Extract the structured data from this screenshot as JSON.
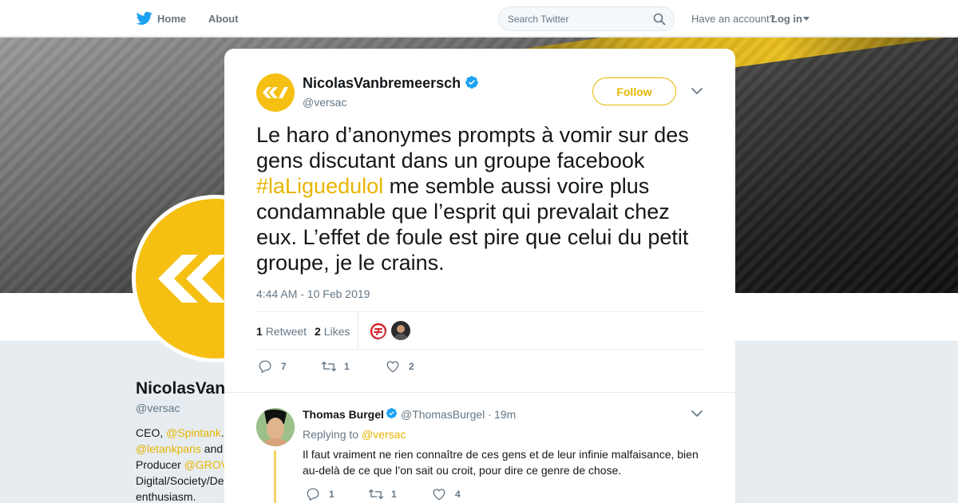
{
  "colors": {
    "accent": "#e8b500",
    "muted": "#657786",
    "text": "#14171a",
    "verified": "#1da1f2"
  },
  "topnav": {
    "home_label": "Home",
    "about_label": "About",
    "search_placeholder": "Search Twitter",
    "account_prompt": "Have an account?",
    "login_label": "Log in"
  },
  "profile_bg": {
    "name": "NicolasVan",
    "handle": "@versac",
    "bio_lines": [
      {
        "pre": "CEO, ",
        "link": "@Spintank",
        "post": "."
      },
      {
        "pre": "",
        "link": "@letankparis",
        "post": " and"
      },
      {
        "pre": "Producer ",
        "link": "@GROV",
        "post": ""
      },
      {
        "pre": "Digital/Society/De",
        "link": "",
        "post": ""
      },
      {
        "pre": "enthusiasm.",
        "link": "",
        "post": ""
      }
    ]
  },
  "tweet": {
    "author_name": "NicolasVanbremeersch",
    "author_handle": "@versac",
    "follow_label": "Follow",
    "text_part1": "Le haro d’anonymes prompts à vomir sur des gens discutant dans un groupe facebook ",
    "hashtag": "#laLiguedulol",
    "text_part2": " me semble aussi voire plus condamnable que l’esprit qui prevalait chez eux. L’effet de foule est pire que celui du petit groupe, je le crains.",
    "timestamp": "4:44 AM - 10 Feb 2019",
    "retweet_count": "1",
    "retweet_label": "Retweet",
    "like_count": "2",
    "like_label": "Likes",
    "actions": {
      "replies": "7",
      "retweets": "1",
      "likes": "2"
    }
  },
  "reply": {
    "author_name": "Thomas Burgel",
    "author_handle": "@ThomasBurgel",
    "separator": "·",
    "time": "19m",
    "replying_label": "Replying to",
    "replying_to": "@versac",
    "text": "Il faut vraiment ne rien connaître de ces gens et de leur infinie malfaisance, bien au-delà de ce que l’on sait ou croit, pour dire ce genre de chose.",
    "actions": {
      "replies": "1",
      "retweets": "1",
      "likes": "4"
    }
  },
  "icons": {
    "logo": "twitter-bird-icon",
    "search": "search-icon",
    "close": "close-icon",
    "verified": "verified-badge-icon",
    "chevron": "chevron-down-icon",
    "reply": "reply-icon",
    "retweet": "retweet-icon",
    "like": "heart-icon"
  }
}
